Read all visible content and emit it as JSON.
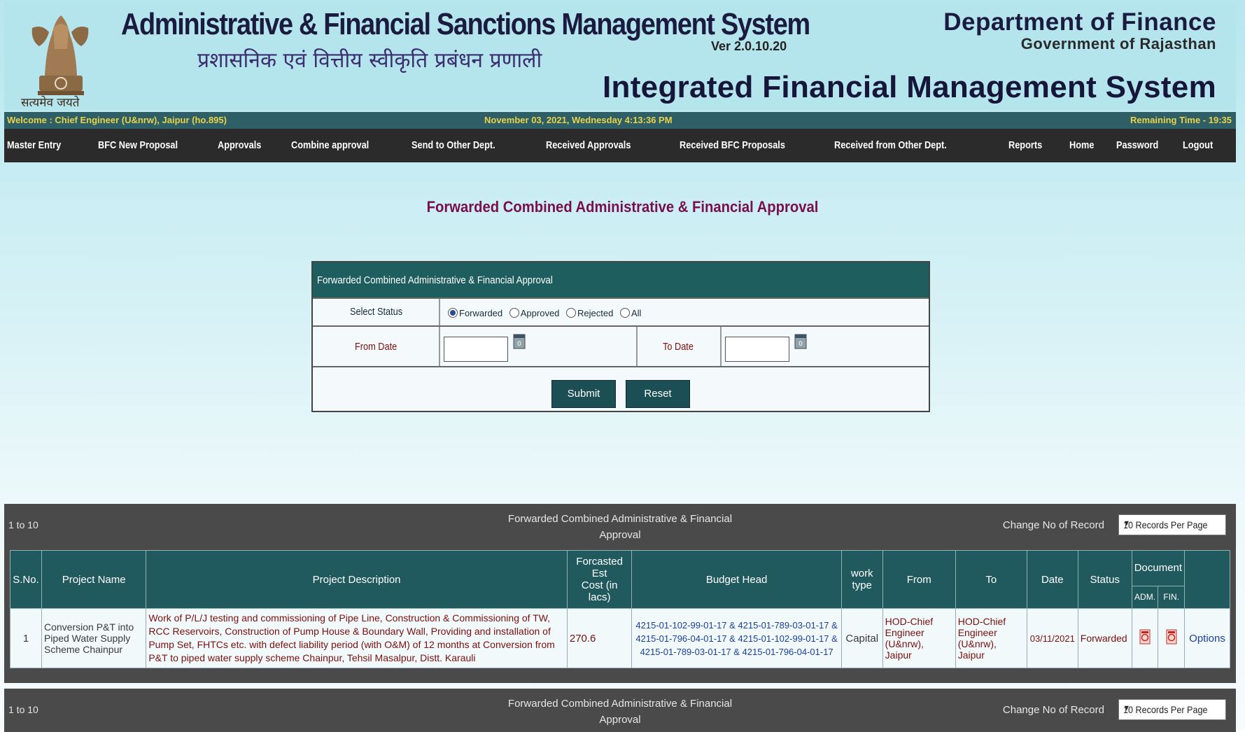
{
  "header": {
    "emblem_caption": "सत्यमेव जयते",
    "system_title": "Administrative & Financial Sanctions Management System",
    "version": "Ver 2.0.10.20",
    "hindi_title": "प्रशासनिक एवं वित्तीय स्वीकृति प्रबंधन प्रणाली",
    "department": "Department of Finance",
    "government": "Government of Rajasthan",
    "ifms": "Integrated Financial Management System"
  },
  "status_bar": {
    "welcome": "Welcome : Chief Engineer (U&nrw), Jaipur (ho.895)",
    "datetime": "November 03, 2021, Wednesday 4:13:36 PM",
    "remaining": "Remaining Time - 19:35"
  },
  "nav": [
    "Master Entry",
    "BFC New Proposal",
    "Approvals",
    "Combine approval",
    "Send to Other Dept.",
    "Received Approvals",
    "Received BFC Proposals",
    "Received from Other Dept.",
    "Reports",
    "Home",
    "Password",
    "Logout"
  ],
  "page_title": "Forwarded Combined Administrative & Financial Approval",
  "form": {
    "heading": "Forwarded Combined Administrative & Financial Approval",
    "select_status_label": "Select Status",
    "status_options": [
      "Forwarded",
      "Approved",
      "Rejected",
      "All"
    ],
    "selected_status": "Forwarded",
    "from_date_label": "From Date",
    "from_date_value": "",
    "to_date_label": "To Date",
    "to_date_value": "",
    "submit_label": "Submit",
    "reset_label": "Reset"
  },
  "grid": {
    "range": "1 to 10",
    "title_line1": "Forwarded Combined Administrative & Financial",
    "title_line2": "Approval",
    "change_label": "Change No of Record",
    "per_page": "10 Records Per Page",
    "columns": {
      "sno": "S.No.",
      "project_name": "Project Name",
      "project_description": "Project Description",
      "cost_line1": "Forcasted Est",
      "cost_line2": "Cost (in lacs)",
      "budget_head": "Budget Head",
      "work_line1": "work",
      "work_line2": "type",
      "from": "From",
      "to": "To",
      "date": "Date",
      "status": "Status",
      "document": "Document",
      "adm": "ADM.",
      "fin": "FIN."
    },
    "rows": [
      {
        "sno": "1",
        "project_name": "Conversion P&T into Piped Water Supply Scheme Chainpur",
        "project_description": "Work of P/L/J testing and commissioning of Pipe Line, Construction & Commissioning of TW, RCC Reservoirs, Construction of Pump House & Boundary Wall, Providing and installation of Pump Set, FHTCs etc. with defect liability period (with O&M) of 12 months at Conversion from P&T to piped water supply scheme Chainpur, Tehsil Masalpur, Distt. Karauli",
        "cost": "270.6",
        "budget_head": "4215-01-102-99-01-17 & 4215-01-789-03-01-17 & 4215-01-796-04-01-17 & 4215-01-102-99-01-17 & 4215-01-789-03-01-17 & 4215-01-796-04-01-17",
        "work_type": "Capital",
        "from": "HOD-Chief Engineer (U&nrw), Jaipur",
        "to": "HOD-Chief Engineer (U&nrw), Jaipur",
        "date": "03/11/2021",
        "status": "Forwarded",
        "options": "Options"
      }
    ]
  },
  "colors": {
    "nav_bg": "#2b2b2b",
    "header_bg": "#b4e4ec",
    "title_accent": "#7a0f4e",
    "table_head": "#215a5e"
  }
}
